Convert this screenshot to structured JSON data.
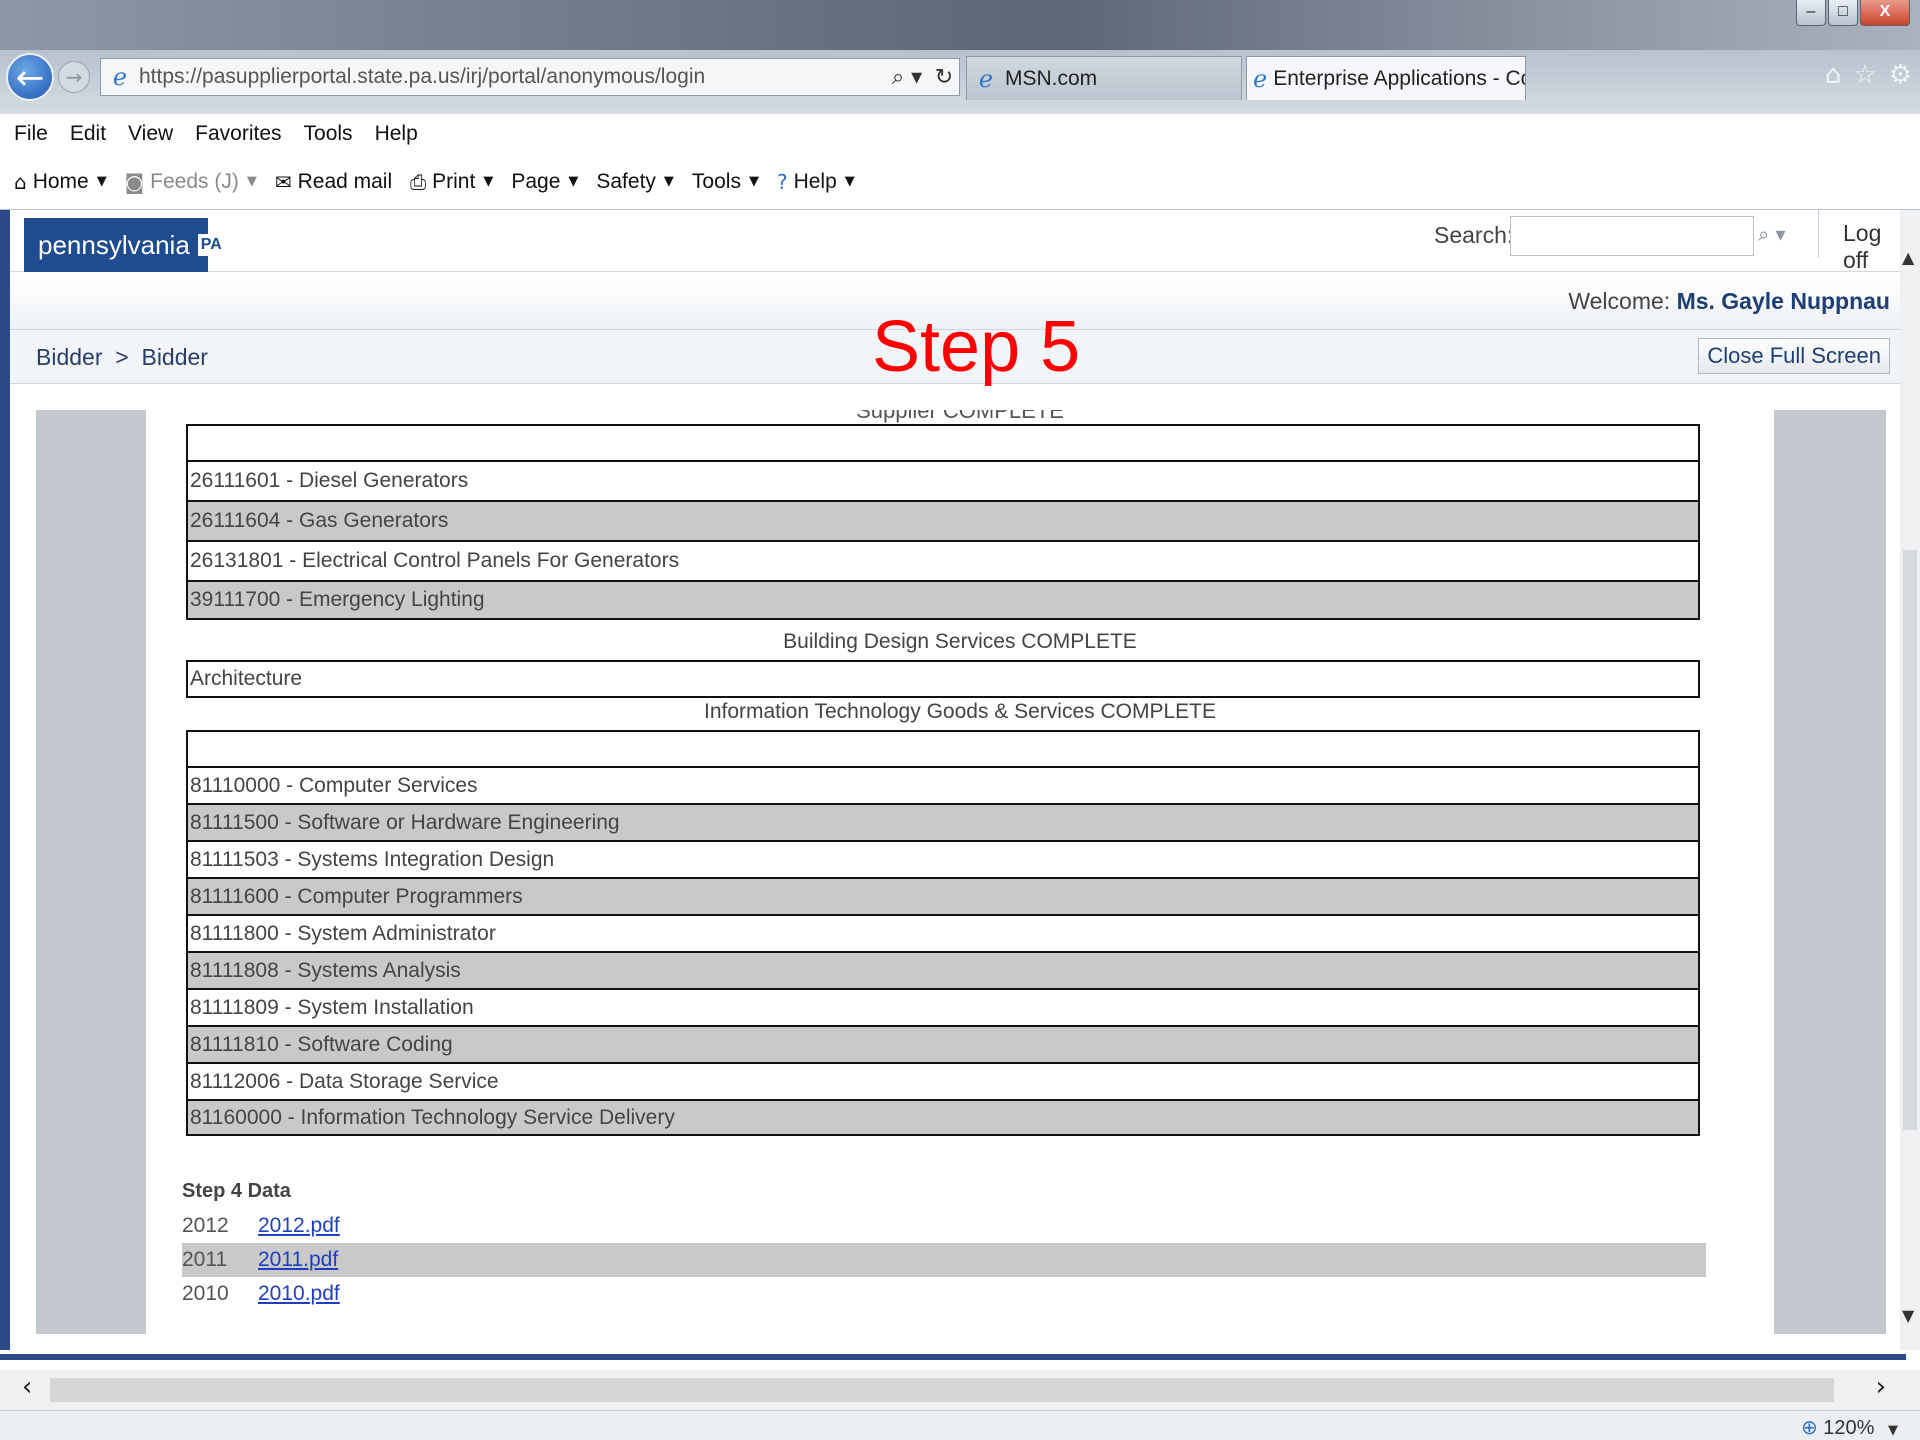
{
  "window": {
    "controls": {
      "minimize": "–",
      "maximize": "□",
      "close": "X"
    }
  },
  "nav": {
    "url": "https://pasupplierportal.state.pa.us/irj/portal/anonymous/login",
    "search_glyph": "⌕ ▾",
    "refresh_glyph": "↻",
    "tabs": [
      {
        "label": "MSN.com"
      },
      {
        "label": "Enterprise Applications - Co...",
        "close": "×"
      }
    ],
    "right_icons": {
      "home": "⌂",
      "favorites": "☆",
      "settings": "⚙"
    }
  },
  "menu": [
    "File",
    "Edit",
    "View",
    "Favorites",
    "Tools",
    "Help"
  ],
  "commands": {
    "home": "Home",
    "feeds": "Feeds (J)",
    "read_mail": "Read mail",
    "print": "Print",
    "page": "Page",
    "safety": "Safety",
    "tools": "Tools",
    "help": "Help"
  },
  "portal": {
    "logo_text": "pennsylvania",
    "logo_badge": "PA",
    "search_label": "Search:",
    "search_value": "",
    "logoff": "Log off",
    "welcome_prefix": "Welcome:",
    "welcome_name": "Ms. Gayle Nuppnau",
    "breadcrumb": "Bidder  >  Bidder",
    "close_full_screen": "Close Full Screen"
  },
  "overlay": {
    "step_label": "Step 5"
  },
  "content": {
    "clipped_section_title": "Supplier COMPLETE",
    "supplier_rows": [
      "26111601 - Diesel Generators",
      "26111604 - Gas Generators",
      "26131801 - Electrical Control Panels For Generators",
      "39111700 - Emergency Lighting"
    ],
    "building_title": "Building Design Services COMPLETE",
    "building_rows": [
      "Architecture"
    ],
    "it_title": "Information Technology Goods & Services COMPLETE",
    "it_rows": [
      "81110000 - Computer Services",
      "81111500 - Software or Hardware Engineering",
      "81111503 - Systems Integration Design",
      "81111600 - Computer Programmers",
      "81111800 - System Administrator",
      "81111808 - Systems Analysis",
      "81111809 - System Installation",
      "81111810 - Software Coding",
      "81112006 - Data Storage Service",
      "81160000 - Information Technology Service Delivery"
    ],
    "step4": {
      "title": "Step 4 Data",
      "rows": [
        {
          "year": "2012",
          "file": "2012.pdf"
        },
        {
          "year": "2011",
          "file": "2011.pdf"
        },
        {
          "year": "2010",
          "file": "2010.pdf"
        }
      ]
    }
  },
  "status": {
    "zoom": "120%"
  },
  "colors": {
    "accent": "#2c4a86",
    "step_overlay": "#ff0000",
    "alt_row": "#c9c9c9",
    "link": "#1f3fc2"
  }
}
